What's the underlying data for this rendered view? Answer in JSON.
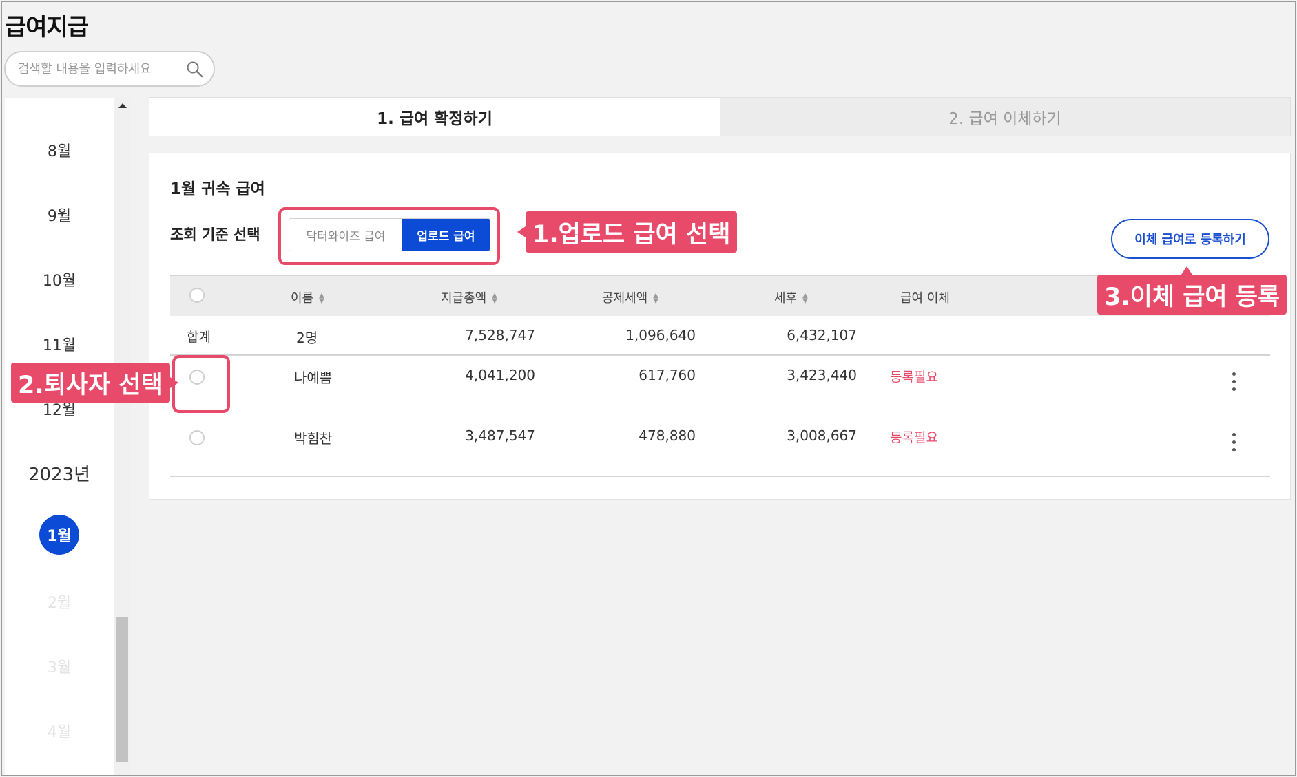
{
  "page": {
    "title": "급여지급"
  },
  "search": {
    "placeholder": "검색할 내용을 입력하세요"
  },
  "sidebar": {
    "months": [
      {
        "label": "8월",
        "state": "normal"
      },
      {
        "label": "9월",
        "state": "normal"
      },
      {
        "label": "10월",
        "state": "normal"
      },
      {
        "label": "11월",
        "state": "normal"
      },
      {
        "label": "12월",
        "state": "normal"
      },
      {
        "label": "2023년",
        "state": "year"
      },
      {
        "label": "1월",
        "state": "selected"
      },
      {
        "label": "2월",
        "state": "faded"
      },
      {
        "label": "3월",
        "state": "faded"
      },
      {
        "label": "4월",
        "state": "faded"
      }
    ]
  },
  "tabs": [
    {
      "label": "1. 급여 확정하기",
      "active": true
    },
    {
      "label": "2. 급여 이체하기",
      "active": false
    }
  ],
  "card": {
    "title": "1월 귀속 급여",
    "filter_label": "조회 기준 선택",
    "toggle": {
      "option_off": "닥터와이즈 급여",
      "option_on": "업로드 급여"
    },
    "register_button": "이체 급여로 등록하기"
  },
  "table": {
    "headers": {
      "name": "이름",
      "gross": "지급총액",
      "deduction": "공제세액",
      "net": "세후",
      "transfer": "급여 이체"
    },
    "total": {
      "label": "합계",
      "count": "2명",
      "gross": "7,528,747",
      "deduction": "1,096,640",
      "net": "6,432,107"
    },
    "rows": [
      {
        "name": "나예쁨",
        "gross": "4,041,200",
        "deduction": "617,760",
        "net": "3,423,440",
        "status": "등록필요"
      },
      {
        "name": "박힘찬",
        "gross": "3,487,547",
        "deduction": "478,880",
        "net": "3,008,667",
        "status": "등록필요"
      }
    ]
  },
  "annotations": {
    "step1": "1.업로드 급여 선택",
    "step2": "2.퇴사자 선택",
    "step3": "3.이체 급여 등록"
  },
  "colors": {
    "accent": "#0b4bd6",
    "annotation": "#e84a6a",
    "status": "#e84a6a"
  }
}
